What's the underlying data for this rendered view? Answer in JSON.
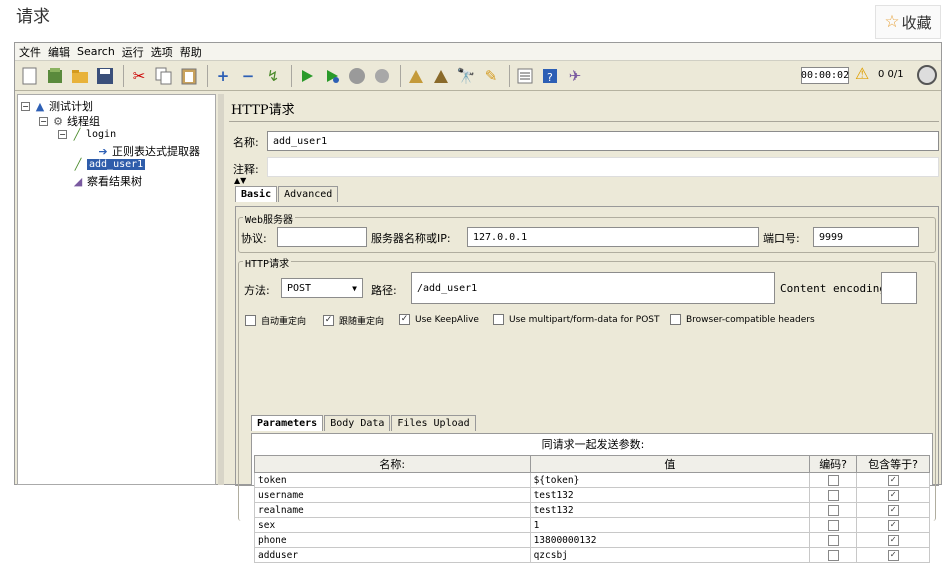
{
  "page": {
    "title": "请求",
    "favorite_label": "收藏"
  },
  "menu": [
    "文件",
    "编辑",
    "Search",
    "运行",
    "选项",
    "帮助"
  ],
  "toolbar": {
    "timer": "00:00:02",
    "thread_count_text": "0  0/1"
  },
  "tree": {
    "test_plan": "测试计划",
    "thread_group": "线程组",
    "login": "login",
    "regex_extractor": "正则表达式提取器",
    "add_user1": "add_user1",
    "result_tree": "察看结果树"
  },
  "panel": {
    "title": "HTTP请求",
    "name_label": "名称:",
    "name_value": "add_user1",
    "comment_label": "注释:",
    "tab_basic": "Basic",
    "tab_advanced": "Advanced",
    "web_server_title": "Web服务器",
    "protocol_label": "协议:",
    "protocol_value": "",
    "server_label": "服务器名称或IP:",
    "server_value": "127.0.0.1",
    "port_label": "端口号:",
    "port_value": "9999",
    "http_request_title": "HTTP请求",
    "method_label": "方法:",
    "method_value": "POST",
    "path_label": "路径:",
    "path_value": "/add_user1",
    "encoding_label": "Content encoding:",
    "encoding_value": "",
    "checkboxes": [
      {
        "label": "自动重定向",
        "checked": false
      },
      {
        "label": "跟随重定向",
        "checked": true
      },
      {
        "label": "Use KeepAlive",
        "checked": true
      },
      {
        "label": "Use multipart/form-data for POST",
        "checked": false
      },
      {
        "label": "Browser-compatible headers",
        "checked": false
      }
    ],
    "tab_parameters": "Parameters",
    "tab_body": "Body Data",
    "tab_files": "Files Upload",
    "params_caption": "同请求一起发送参数:",
    "columns": [
      "名称:",
      "值",
      "编码?",
      "包含等于?"
    ],
    "rows": [
      {
        "name": "token",
        "value": "${token}"
      },
      {
        "name": "username",
        "value": "test132"
      },
      {
        "name": "realname",
        "value": "test132"
      },
      {
        "name": "sex",
        "value": "1"
      },
      {
        "name": "phone",
        "value": "13800000132"
      },
      {
        "name": "adduser",
        "value": "qzcsbj"
      }
    ]
  }
}
